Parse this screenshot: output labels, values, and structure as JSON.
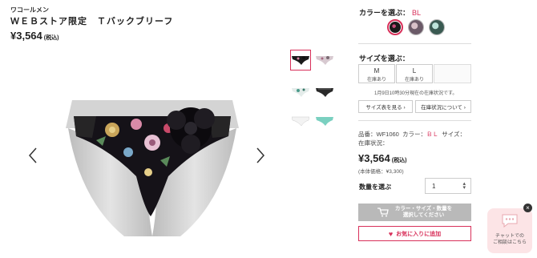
{
  "product": {
    "brand": "ワコールメン",
    "title": "ＷＥＢストア限定　Ｔバックブリーフ",
    "price": "¥3,564",
    "tax_label": "(税込)"
  },
  "gallery": {
    "prev_icon": "chevron-left-icon",
    "next_icon": "chevron-right-icon"
  },
  "color": {
    "label": "カラーを選ぶ：",
    "value": "BL",
    "swatches": [
      "#1a1a1a",
      "#6b5a68",
      "#4a7a70"
    ]
  },
  "size": {
    "label": "サイズを選ぶ：",
    "options": [
      {
        "size": "M",
        "status": "在庫あり"
      },
      {
        "size": "L",
        "status": "在庫あり"
      }
    ],
    "stock_note": "1月9日10時30分現在の在庫状況です。",
    "size_chart_btn": "サイズ表を見る ›",
    "stock_status_btn": "在庫状況について ›"
  },
  "spec": {
    "code_label": "品番：",
    "code": "WF1060",
    "color_label": "カラー：",
    "color_value": "ＢＬ",
    "size_label": "サイズ：",
    "stock_label": "在庫状況："
  },
  "pricing": {
    "price": "¥3,564",
    "tax_label": "(税込)",
    "sub": "(本体価格：¥3,300)"
  },
  "quantity": {
    "label": "数量を選ぶ",
    "value": "1"
  },
  "cart": {
    "line1": "カラー・サイズ・数量を",
    "line2": "選択してください"
  },
  "favorite": {
    "label": "お気に入りに追加"
  },
  "chat": {
    "line1": "チャットでの",
    "line2": "ご相談はこちら",
    "close": "×"
  },
  "colors": {
    "accent": "#d8305a",
    "disabled": "#b9b9b9",
    "chat_bg": "#fce4e6"
  }
}
